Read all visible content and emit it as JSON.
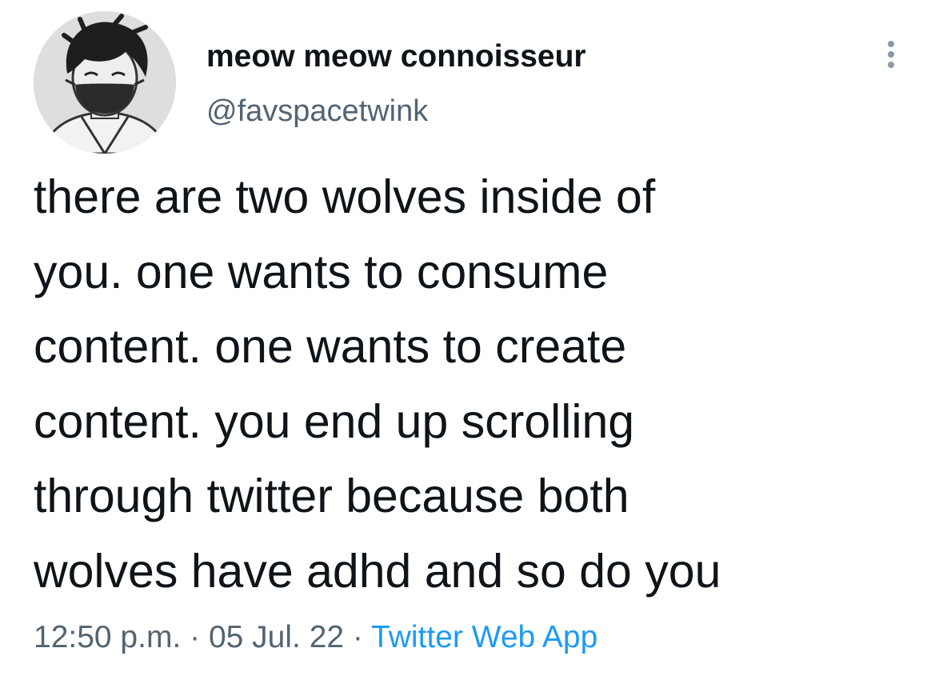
{
  "author": {
    "display_name": "meow meow connoisseur",
    "handle": "@favspacetwink",
    "avatar_icon": "illustrated-avatar-with-face-mask"
  },
  "menu": {
    "icon": "more-vertical-icon"
  },
  "tweet": {
    "lines": [
      "there are two wolves inside of",
      "you. one wants to consume",
      "content. one wants to create",
      "content. you end up scrolling",
      "through twitter because both",
      "wolves have adhd and so do you"
    ]
  },
  "meta": {
    "time": "12:50 p.m.",
    "separator": " · ",
    "date": "05 Jul. 22",
    "source": "Twitter Web App"
  },
  "colors": {
    "text": "#0f1419",
    "secondary": "#536471",
    "link": "#1d9bf0",
    "background": "#ffffff"
  }
}
